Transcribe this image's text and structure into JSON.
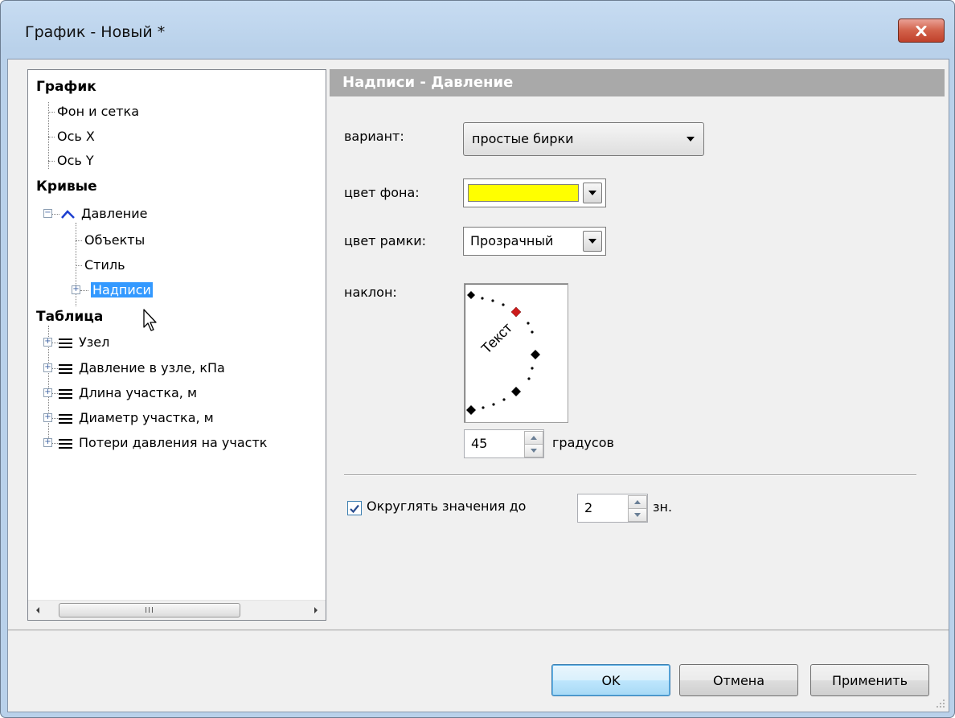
{
  "window": {
    "title": "График - Новый *"
  },
  "tree": {
    "items": [
      {
        "label": "График",
        "bold": true
      },
      {
        "label": "Фон и сетка"
      },
      {
        "label": "Ось X"
      },
      {
        "label": "Ось Y"
      },
      {
        "label": "Кривые",
        "bold": true
      },
      {
        "label": "Давление"
      },
      {
        "label": "Объекты"
      },
      {
        "label": "Стиль"
      },
      {
        "label": "Надписи",
        "selected": true
      },
      {
        "label": "Таблица",
        "bold": true
      },
      {
        "label": "Узел"
      },
      {
        "label": "Давление в узле, кПа"
      },
      {
        "label": "Длина участка, м"
      },
      {
        "label": "Диаметр участка, м"
      },
      {
        "label": "Потери давления на участк"
      }
    ],
    "scroll_thumb_glyph": "III"
  },
  "panel": {
    "header": "Надписи - Давление",
    "variant": {
      "label": "вариант:",
      "value": "простые бирки"
    },
    "bg_color": {
      "label": "цвет фона:",
      "color": "#ffff00"
    },
    "border_color": {
      "label": "цвет рамки:",
      "value": "Прозрачный"
    },
    "tilt": {
      "label": "наклон:",
      "sample_text": "Текст",
      "value": "45",
      "unit": "градусов"
    },
    "rounding": {
      "label": "Округлять значения до",
      "checked": true,
      "value": "2",
      "unit": "зн."
    }
  },
  "buttons": {
    "ok": "OK",
    "cancel": "Отмена",
    "apply": "Применить"
  },
  "colors": {
    "selection": "#3399ff",
    "header_bar": "#a9a9a9",
    "close_button": "#c7422c"
  }
}
